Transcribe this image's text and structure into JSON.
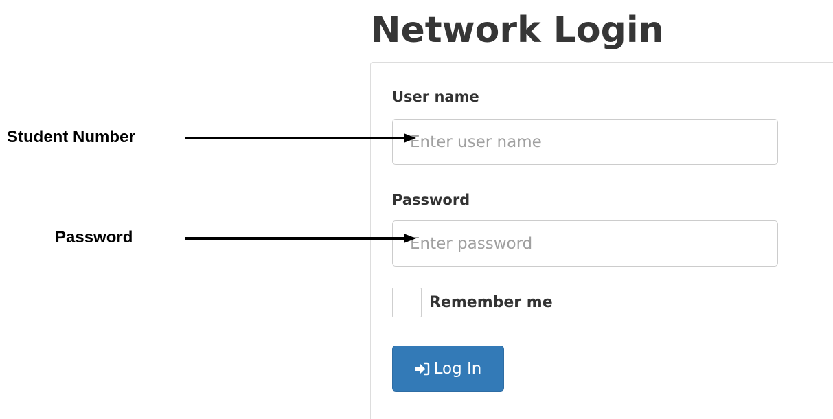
{
  "page": {
    "title": "Network Login"
  },
  "form": {
    "username_label": "User name",
    "username_placeholder": "Enter user name",
    "username_value": "",
    "password_label": "Password",
    "password_placeholder": "Enter password",
    "password_value": "",
    "remember_label": "Remember me",
    "remember_checked": false,
    "login_button_label": "Log In",
    "login_icon": "sign-in-icon"
  },
  "annotations": [
    {
      "label": "Student Number",
      "points_to": "username field"
    },
    {
      "label": "Password",
      "points_to": "password field"
    }
  ],
  "colors": {
    "primary_button": "#337ab7",
    "primary_button_border": "#2e6da4",
    "title_text": "#363636",
    "annotation_arrow": "#000000"
  }
}
